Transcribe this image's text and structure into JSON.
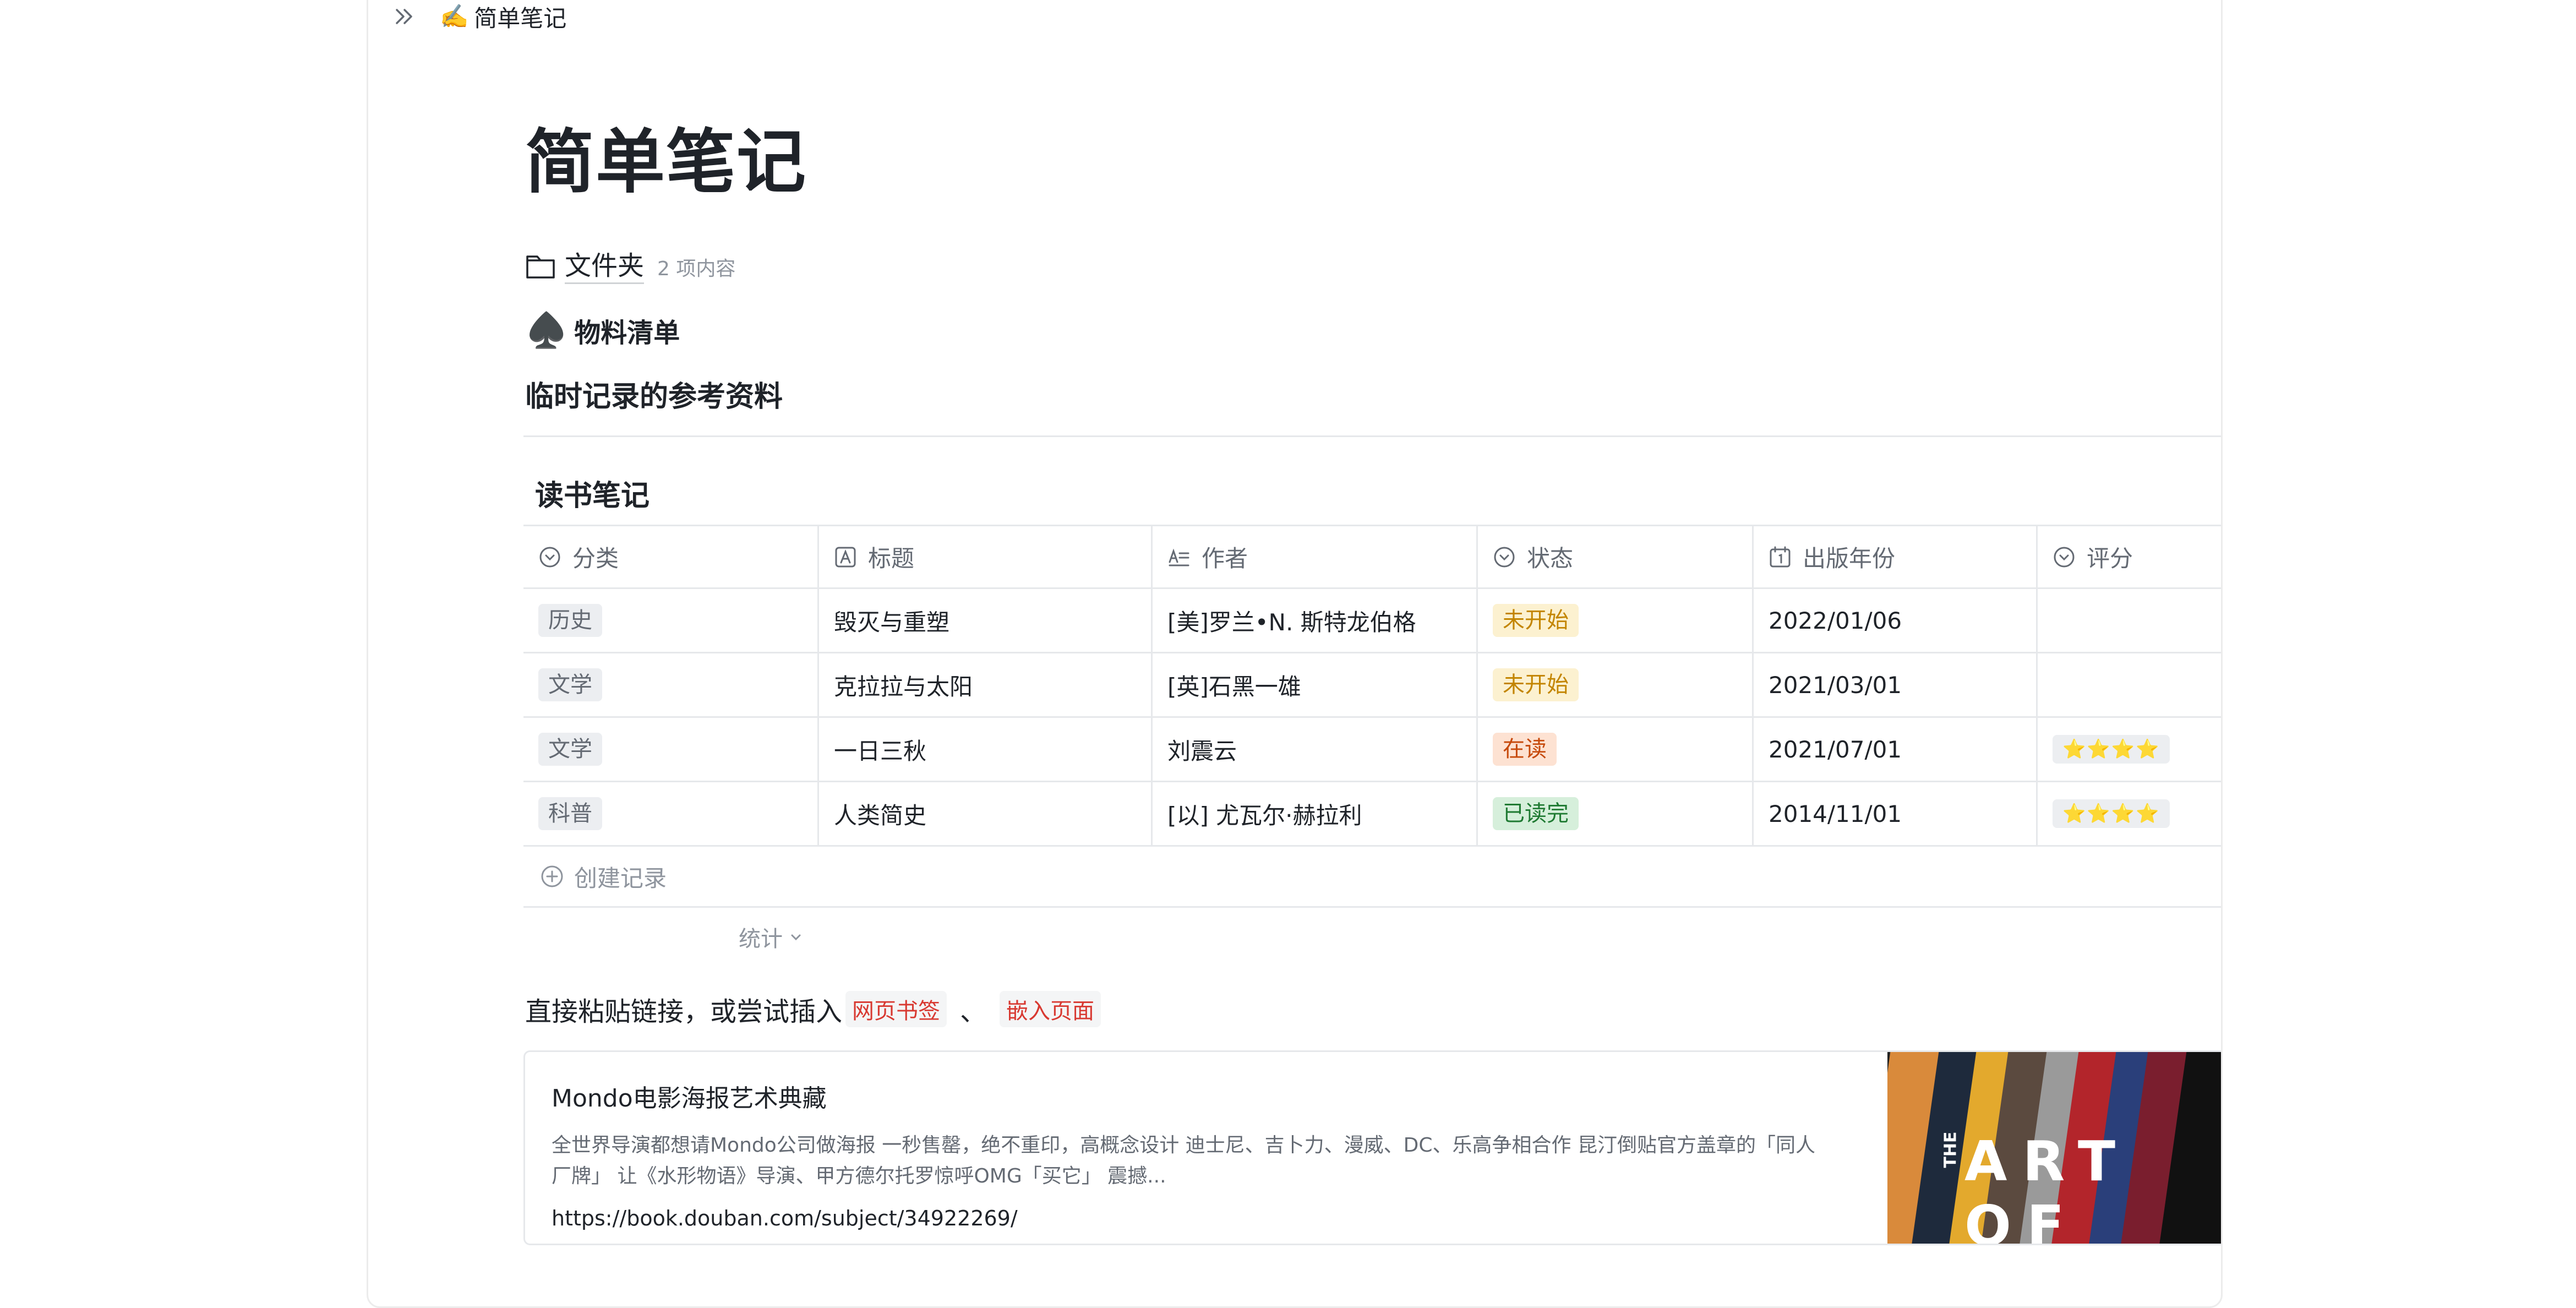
{
  "breadcrumb": {
    "emoji": "✍️",
    "title": "简单笔记"
  },
  "page": {
    "title": "简单笔记"
  },
  "folder": {
    "name": "文件夹",
    "count": "2 项内容"
  },
  "spade_item": {
    "emoji": "♠️",
    "label": "物料清单"
  },
  "ref_heading": "临时记录的参考资料",
  "table": {
    "title": "读书笔记",
    "columns": [
      {
        "label": "分类",
        "icon": "select-icon"
      },
      {
        "label": "标题",
        "icon": "text-field-icon"
      },
      {
        "label": "作者",
        "icon": "text-lines-icon"
      },
      {
        "label": "状态",
        "icon": "select-icon"
      },
      {
        "label": "出版年份",
        "icon": "calendar-icon"
      },
      {
        "label": "评分",
        "icon": "select-icon"
      }
    ],
    "rows": [
      {
        "category": "历史",
        "title": "毁灭与重塑",
        "author": "[美]罗兰•N. 斯特龙伯格",
        "status": "未开始",
        "status_color": "#c38500",
        "year": "2022/01/06",
        "rating": ""
      },
      {
        "category": "文学",
        "title": "克拉拉与太阳",
        "author": "[英]石黑一雄",
        "status": "未开始",
        "status_color": "#c38500",
        "year": "2021/03/01",
        "rating": ""
      },
      {
        "category": "文学",
        "title": "一日三秋",
        "author": "刘震云",
        "status": "在读",
        "status_color": "#c6490a",
        "year": "2021/07/01",
        "rating": "⭐⭐⭐⭐"
      },
      {
        "category": "科普",
        "title": "人类简史",
        "author": "[以] 尤瓦尔·赫拉利",
        "status": "已读完",
        "status_color": "#1f7a32",
        "year": "2014/11/01",
        "rating": "⭐⭐⭐⭐"
      }
    ],
    "create_label": "创建记录",
    "stats_label": "统计"
  },
  "paste": {
    "text": "直接粘贴链接，或尝试插入",
    "link1": "网页书签",
    "separator": "、",
    "link2": "嵌入页面"
  },
  "bookmark": {
    "title": "Mondo电影海报艺术典藏",
    "description": "全世界导演都想请Mondo公司做海报 一秒售罄，绝不重印，高概念设计 迪士尼、吉卜力、漫威、DC、乐高争相合作 昆汀倒贴官方盖章的「同人厂牌」 让《水形物语》导演、甲方德尔托罗惊呼OMG「买它」 震撼...",
    "url": "https://book.douban.com/subject/34922269/",
    "image_text": "ART OF",
    "image_small_text": "THE"
  }
}
